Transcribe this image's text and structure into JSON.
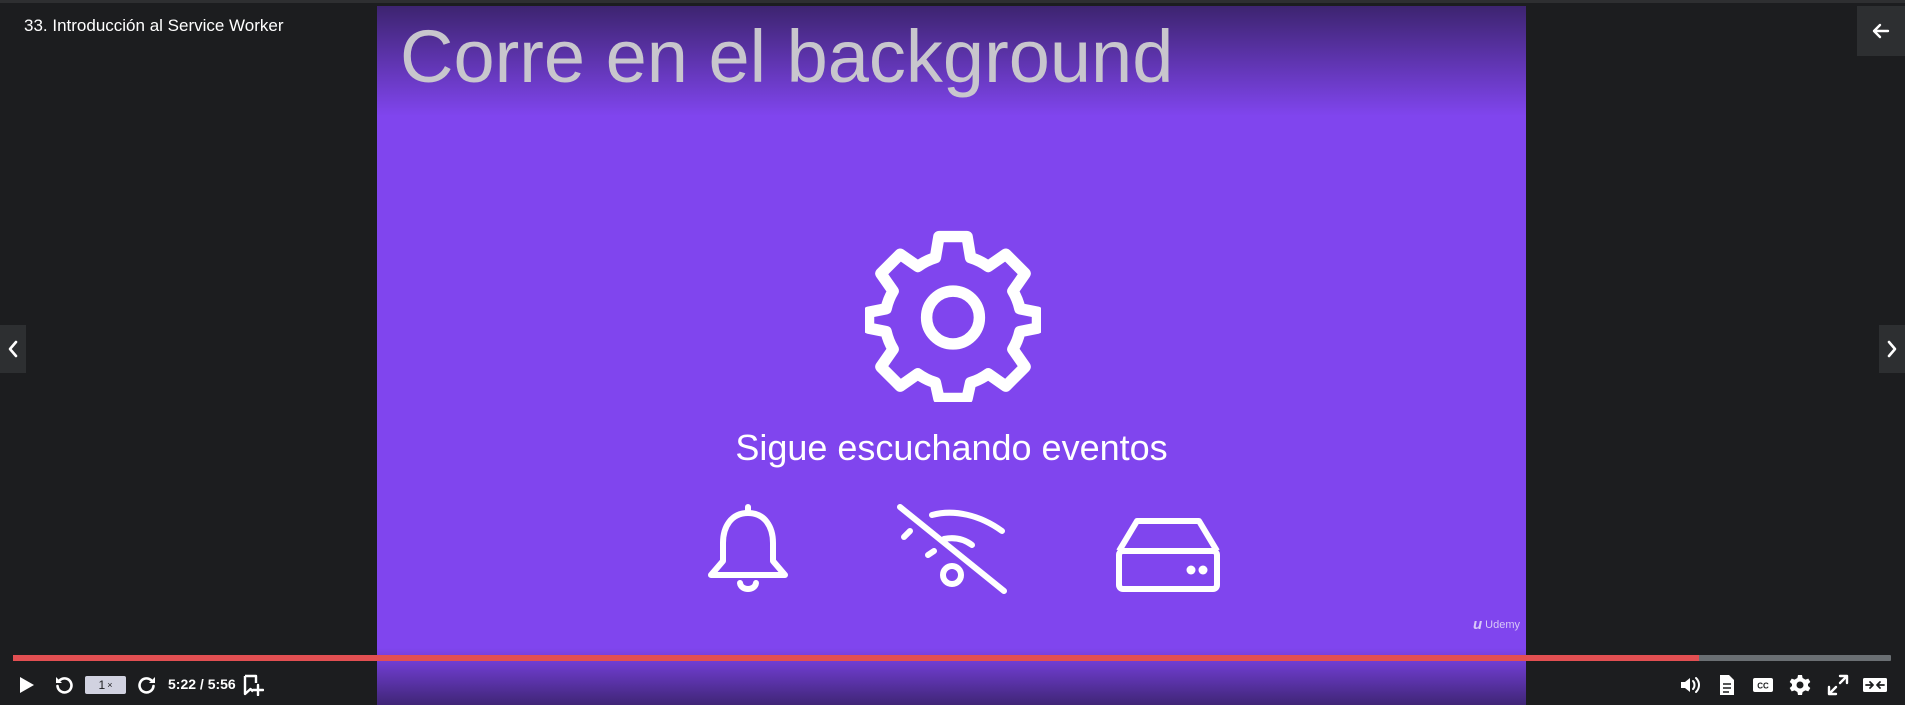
{
  "lecture": {
    "title": "33. Introducción al Service Worker"
  },
  "slide": {
    "title": "Corre en el background",
    "subtitle": "Sigue escuchando eventos",
    "icons": [
      "gear-icon",
      "bell-icon",
      "wifi-off-icon",
      "hard-drive-icon"
    ],
    "watermark": "Udemy",
    "background_color": "#8045ee"
  },
  "player": {
    "progress": 0.898,
    "progress_color": "#e24f52",
    "speed_label": "1",
    "speed_suffix": "×",
    "time_display": "5:22 / 5:56"
  },
  "controls": {
    "left": [
      "play-icon",
      "rewind-icon",
      "speed-button",
      "forward-icon",
      "add-bookmark-icon"
    ],
    "right": [
      "volume-icon",
      "transcript-icon",
      "captions-icon",
      "settings-icon",
      "fullscreen-icon",
      "expand-icon"
    ]
  }
}
